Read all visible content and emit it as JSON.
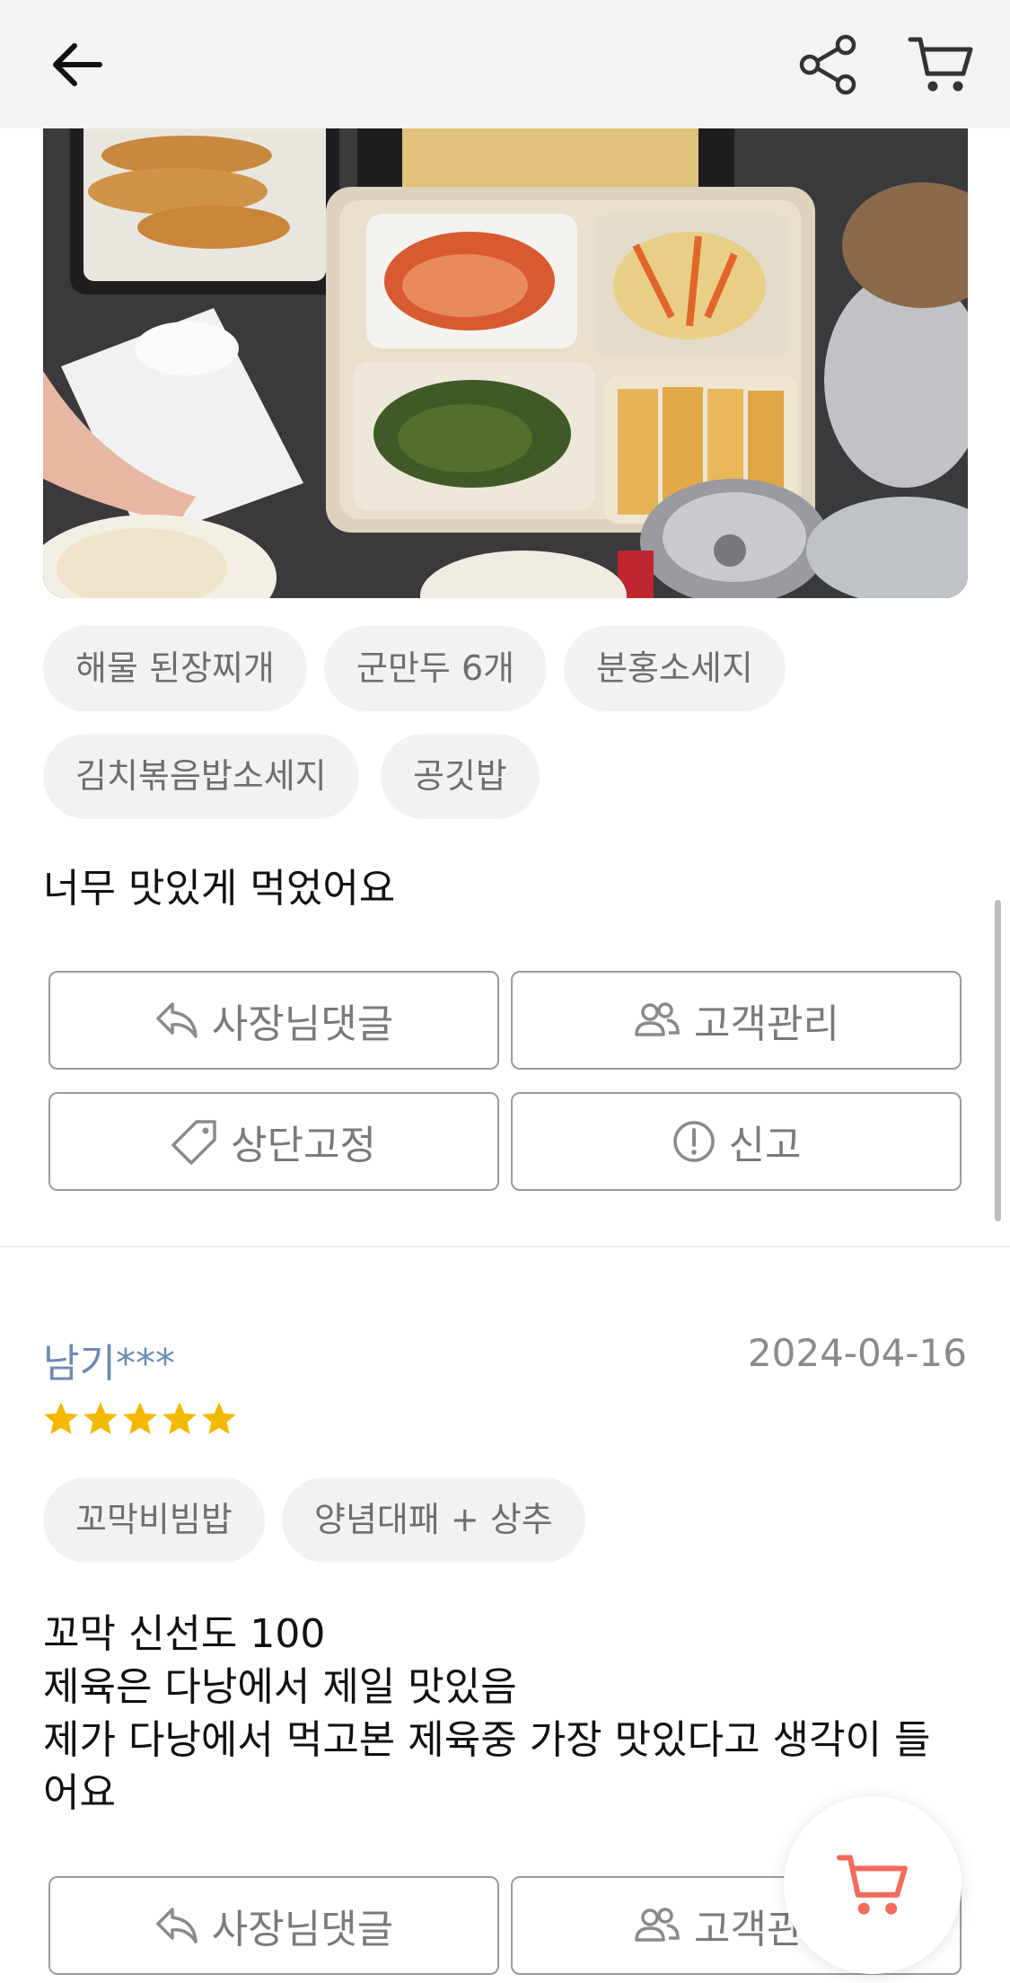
{
  "review1": {
    "tags": [
      "해물 된장찌개",
      "군만두 6개",
      "분홍소세지",
      "김치볶음밥소세지",
      "공깃밥"
    ],
    "text": "너무 맛있게 먹었어요",
    "actions": {
      "owner_reply": "사장님댓글",
      "customer_mgmt": "고객관리",
      "pin_top": "상단고정",
      "report": "신고"
    }
  },
  "review2": {
    "username": "남기***",
    "date": "2024-04-16",
    "rating": 5,
    "tags": [
      "꼬막비빔밥",
      "양념대패 + 상추"
    ],
    "text_lines": [
      "꼬막 신선도 100",
      "제육은 다낭에서 제일 맛있음",
      "제가 다낭에서 먹고본 제육중 가장 맛있다고 생각이 들",
      "어요"
    ],
    "actions": {
      "owner_reply": "사장님댓글",
      "customer_mgmt": "고객관리"
    }
  },
  "colors": {
    "star": "#f5b800",
    "username": "#6d8ab5",
    "fab_cart": "#f26b5b",
    "chip_bg": "#f2f2f2"
  },
  "icons": [
    "back-arrow-icon",
    "share-icon",
    "cart-icon",
    "reply-icon",
    "people-icon",
    "tag-icon",
    "alert-circle-icon",
    "star-icon"
  ]
}
